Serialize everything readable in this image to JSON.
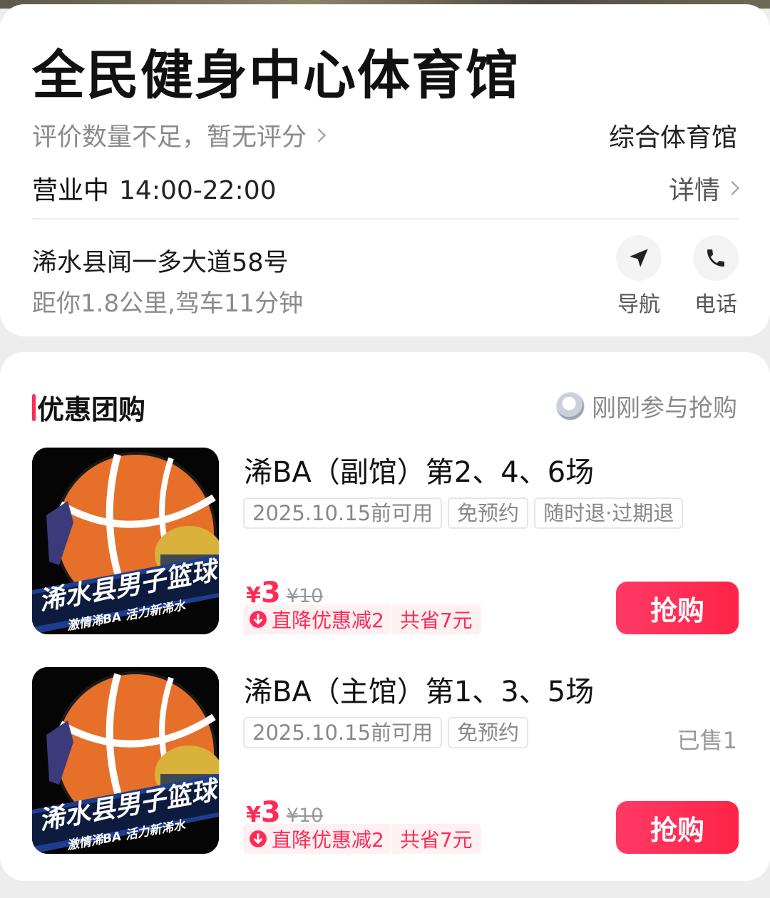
{
  "shop": {
    "name": "全民健身中心体育馆",
    "rating_text": "评价数量不足，暂无评分",
    "category": "综合体育馆",
    "status": "营业中",
    "hours": "14:00-22:00",
    "details_label": "详情",
    "address": "浠水县闻一多大道58号",
    "distance": "距你1.8公里,驾车11分钟",
    "actions": {
      "navigate": "导航",
      "phone": "电话"
    }
  },
  "deals_section": {
    "title": "优惠团购",
    "participants_text": "刚刚参与抢购",
    "items": [
      {
        "title": "浠BA（副馆）第2、4、6场",
        "tags": [
          "2025.10.15前可用",
          "免预约",
          "随时退·过期退"
        ],
        "sold": "",
        "currency": "¥",
        "price": "3",
        "original_price": "¥10",
        "discount": "直降优惠减2",
        "saving": "共省7元",
        "button": "抢购",
        "thumb": {
          "banner": "浠水县男子篮球",
          "slogan": "激情浠BA  活力新浠水"
        }
      },
      {
        "title": "浠BA（主馆）第1、3、5场",
        "tags": [
          "2025.10.15前可用",
          "免预约"
        ],
        "sold": "已售1",
        "currency": "¥",
        "price": "3",
        "original_price": "¥10",
        "discount": "直降优惠减2",
        "saving": "共省7元",
        "button": "抢购",
        "thumb": {
          "banner": "浠水县男子篮球",
          "slogan": "激情浠BA  活力新浠水"
        }
      }
    ]
  },
  "colors": {
    "accent": "#ff2b55",
    "badge_bg": "#fff0f2",
    "muted": "#8a8a8a"
  },
  "icons": [
    "chevron-right-icon",
    "navigate-arrow-icon",
    "phone-icon",
    "down-arrow-icon",
    "avatar"
  ]
}
